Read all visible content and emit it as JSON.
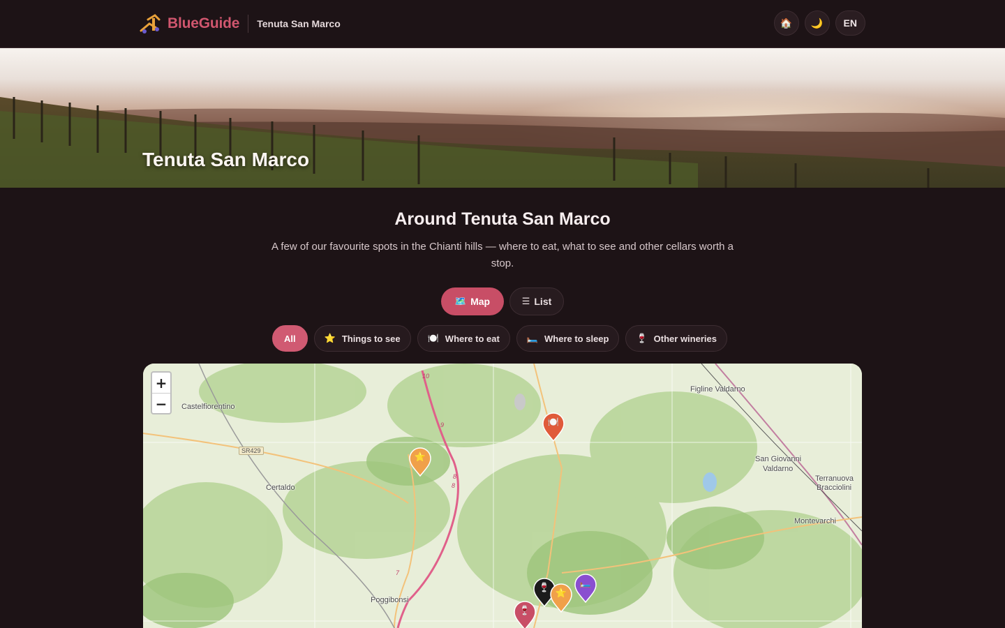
{
  "header": {
    "brand_name": "BlueGuide",
    "subtitle": "Tenuta San Marco",
    "home_icon": "🏠",
    "theme_icon": "🌙",
    "language": "EN"
  },
  "hero": {
    "title": "Tenuta San Marco"
  },
  "section": {
    "title": "Around Tenuta San Marco",
    "description": "A few of our favourite spots in the Chianti hills — where to eat, what to see and other cellars worth a stop."
  },
  "view_toggle": {
    "map": {
      "icon": "🗺️",
      "label": "Map",
      "active": true
    },
    "list": {
      "icon": "☰",
      "label": "List",
      "active": false
    }
  },
  "filters": [
    {
      "icon": "",
      "label": "All",
      "active": true
    },
    {
      "icon": "⭐",
      "label": "Things to see",
      "active": false
    },
    {
      "icon": "🍽️",
      "label": "Where to eat",
      "active": false
    },
    {
      "icon": "🛏️",
      "label": "Where to sleep",
      "active": false
    },
    {
      "icon": "🍷",
      "label": "Other wineries",
      "active": false
    }
  ],
  "map": {
    "zoom_in": "+",
    "zoom_out": "−",
    "places": [
      "Castelfiorentino",
      "Figline Valdarno",
      "San Giovanni",
      "Valdarno",
      "Terranuova",
      "Bracciolini",
      "Certaldo",
      "Montevarchi",
      "Poggibonsi"
    ],
    "road_labels": [
      "10",
      "9",
      "8",
      "8",
      "7"
    ],
    "route_shield": "SR429",
    "markers": [
      {
        "category": "Where to eat",
        "icon": "🍽️",
        "color": "#e05a3a"
      },
      {
        "category": "Things to see",
        "icon": "⭐",
        "color": "#f0a04a"
      },
      {
        "category": "Other wineries",
        "icon": "🍷",
        "color": "#1b1b1b"
      },
      {
        "category": "Things to see",
        "icon": "⭐",
        "color": "#f0a04a"
      },
      {
        "category": "Where to sleep",
        "icon": "🛏️",
        "color": "#8a4fd0"
      },
      {
        "category": "Other wineries",
        "icon": "🍷",
        "color": "#c84e66"
      }
    ]
  },
  "colors": {
    "brand": "#d0566e",
    "accent": "#c84e66",
    "background": "#1d1316"
  }
}
